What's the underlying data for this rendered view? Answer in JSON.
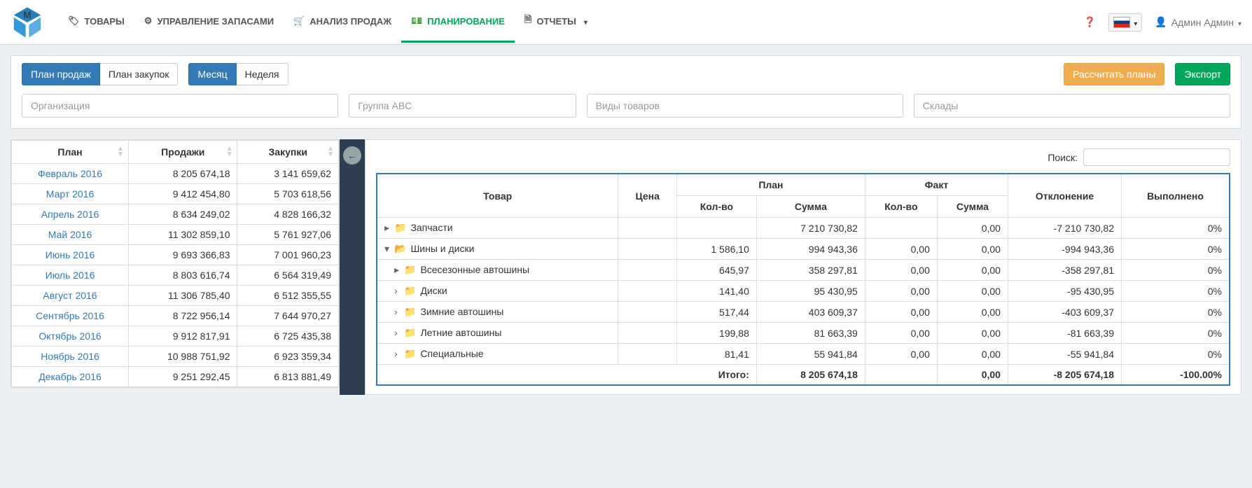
{
  "nav": {
    "items": [
      {
        "label": "ТОВАРЫ",
        "icon": "tags"
      },
      {
        "label": "УПРАВЛЕНИЕ ЗАПАСАМИ",
        "icon": "dashboard"
      },
      {
        "label": "АНАЛИЗ ПРОДАЖ",
        "icon": "cart"
      },
      {
        "label": "ПЛАНИРОВАНИЕ",
        "icon": "money",
        "active": true
      },
      {
        "label": "ОТЧЕТЫ",
        "icon": "file",
        "dropdown": true
      }
    ],
    "user": "Админ Админ"
  },
  "toolbar": {
    "plan_type": {
      "sales": "План продаж",
      "purchases": "План закупок"
    },
    "period": {
      "month": "Месяц",
      "week": "Неделя"
    },
    "calculate": "Рассчитать планы",
    "export": "Экспорт"
  },
  "filters": {
    "org": "Организация",
    "abc": "Группа ABC",
    "types": "Виды товаров",
    "warehouses": "Склады"
  },
  "left_table": {
    "headers": {
      "plan": "План",
      "sales": "Продажи",
      "purchases": "Закупки"
    },
    "rows": [
      {
        "plan": "Февраль 2016",
        "sales": "8 205 674,18",
        "purchases": "3 141 659,62"
      },
      {
        "plan": "Март 2016",
        "sales": "9 412 454,80",
        "purchases": "5 703 618,56"
      },
      {
        "plan": "Апрель 2016",
        "sales": "8 634 249,02",
        "purchases": "4 828 166,32"
      },
      {
        "plan": "Май 2016",
        "sales": "11 302 859,10",
        "purchases": "5 761 927,06"
      },
      {
        "plan": "Июнь 2016",
        "sales": "9 693 366,83",
        "purchases": "7 001 960,23"
      },
      {
        "plan": "Июль 2016",
        "sales": "8 803 616,74",
        "purchases": "6 564 319,49"
      },
      {
        "plan": "Август 2016",
        "sales": "11 306 785,40",
        "purchases": "6 512 355,55"
      },
      {
        "plan": "Сентябрь 2016",
        "sales": "8 722 956,14",
        "purchases": "7 644 970,27"
      },
      {
        "plan": "Октябрь 2016",
        "sales": "9 912 817,91",
        "purchases": "6 725 435,38"
      },
      {
        "plan": "Ноябрь 2016",
        "sales": "10 988 751,92",
        "purchases": "6 923 359,34"
      },
      {
        "plan": "Декабрь 2016",
        "sales": "9 251 292,45",
        "purchases": "6 813 881,49"
      }
    ]
  },
  "right_table": {
    "search_label": "Поиск:",
    "headers": {
      "product": "Товар",
      "price": "Цена",
      "plan": "План",
      "fact": "Факт",
      "qty": "Кол-во",
      "sum": "Сумма",
      "deviation": "Отклонение",
      "done": "Выполнено"
    },
    "rows": [
      {
        "indent": 0,
        "toggle": "▸",
        "folder": "closed",
        "name": "Запчасти",
        "qty_p": "",
        "sum_p": "7 210 730,82",
        "qty_f": "",
        "sum_f": "0,00",
        "dev": "-7 210 730,82",
        "done": "0%"
      },
      {
        "indent": 0,
        "toggle": "▾",
        "folder": "open",
        "name": "Шины и диски",
        "qty_p": "1 586,10",
        "sum_p": "994 943,36",
        "qty_f": "0,00",
        "sum_f": "0,00",
        "dev": "-994 943,36",
        "done": "0%"
      },
      {
        "indent": 1,
        "toggle": "▸",
        "folder": "closed",
        "name": "Всесезонные автошины",
        "qty_p": "645,97",
        "sum_p": "358 297,81",
        "qty_f": "0,00",
        "sum_f": "0,00",
        "dev": "-358 297,81",
        "done": "0%"
      },
      {
        "indent": 1,
        "toggle": "›",
        "folder": "closed",
        "name": "Диски",
        "qty_p": "141,40",
        "sum_p": "95 430,95",
        "qty_f": "0,00",
        "sum_f": "0,00",
        "dev": "-95 430,95",
        "done": "0%"
      },
      {
        "indent": 1,
        "toggle": "›",
        "folder": "closed",
        "name": "Зимние автошины",
        "qty_p": "517,44",
        "sum_p": "403 609,37",
        "qty_f": "0,00",
        "sum_f": "0,00",
        "dev": "-403 609,37",
        "done": "0%"
      },
      {
        "indent": 1,
        "toggle": "›",
        "folder": "closed",
        "name": "Летние автошины",
        "qty_p": "199,88",
        "sum_p": "81 663,39",
        "qty_f": "0,00",
        "sum_f": "0,00",
        "dev": "-81 663,39",
        "done": "0%"
      },
      {
        "indent": 1,
        "toggle": "›",
        "folder": "closed",
        "name": "Специальные",
        "qty_p": "81,41",
        "sum_p": "55 941,84",
        "qty_f": "0,00",
        "sum_f": "0,00",
        "dev": "-55 941,84",
        "done": "0%"
      }
    ],
    "total": {
      "label": "Итого:",
      "sum_p": "8 205 674,18",
      "sum_f": "0,00",
      "dev": "-8 205 674,18",
      "done": "-100.00%"
    }
  }
}
